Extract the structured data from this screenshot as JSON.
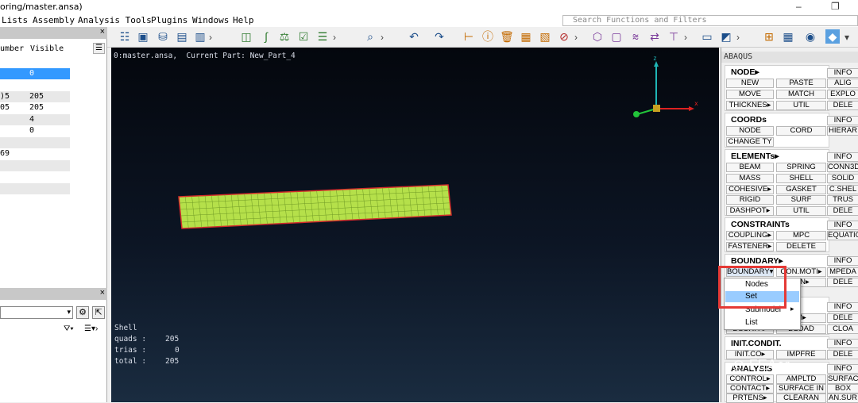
{
  "window": {
    "title": "oring/master.ansa)",
    "controls": [
      "–",
      "❐"
    ]
  },
  "menubar": {
    "items": [
      "Lists",
      "Assembly",
      "Analysis Tools",
      "Plugins",
      "Windows",
      "Help"
    ]
  },
  "search": {
    "placeholder": "Search Functions and Filters"
  },
  "left_panel": {
    "close": "×",
    "col_number": "umber",
    "col_visible": "Visible",
    "rows": [
      {
        "number": "",
        "visible": "0"
      },
      {
        "number": "",
        "visible": ""
      },
      {
        "number": ")5",
        "visible": "205"
      },
      {
        "number": "05",
        "visible": "205"
      },
      {
        "number": "",
        "visible": "4"
      },
      {
        "number": "",
        "visible": "0"
      },
      {
        "number": "",
        "visible": ""
      },
      {
        "number": "69",
        "visible": ""
      },
      {
        "number": "",
        "visible": ""
      },
      {
        "number": "",
        "visible": ""
      },
      {
        "number": "",
        "visible": ""
      }
    ],
    "close2": "×"
  },
  "viewport": {
    "header": "0:master.ansa,  Current Part: New_Part_4",
    "axis_z": "z",
    "axis_x": "x",
    "stats_title": "Shell",
    "stats": [
      {
        "label": "quads :",
        "value": "205"
      },
      {
        "label": "trias :",
        "value": "0"
      },
      {
        "label": "total :",
        "value": "205"
      }
    ],
    "mesh_color": "#b5e04a"
  },
  "right_panel": {
    "title": "ABAQUS",
    "node_head": "NODE▸",
    "node_info": "INFO",
    "node_btns": [
      "NEW",
      "PASTE",
      "ALIG",
      "MOVE",
      "MATCH",
      "EXPLO",
      "THICKNES▸",
      "UTIL",
      "DELE"
    ],
    "coords_head": "COORDs",
    "coords_info": "INFO",
    "coords_btns": [
      "NODE",
      "CORD",
      "HIERAR",
      "CHANGE TY"
    ],
    "elements_head": "ELEMENTs▸",
    "elements_info": "INFO",
    "elements_btns": [
      "BEAM",
      "SPRING",
      "CONN3D",
      "MASS",
      "SHELL",
      "SOLID",
      "COHESIVE▸",
      "GASKET",
      "C.SHEL",
      "RIGID",
      "SURF",
      "TRUS",
      "DASHPOT▸",
      "UTIL",
      "DELE"
    ],
    "constraints_head": "CONSTRAINTs",
    "constraints_info": "INFO",
    "constraints_btns": [
      "COUPLING▸",
      "MPC",
      "EQUATIO",
      "FASTENER▸",
      "DELETE"
    ],
    "boundary_head": "BOUNDARY▸",
    "boundary_info": "INFO",
    "boundary_btns": [
      "BOUNDARY▾",
      "CON.MOTI▸",
      "MPEDA",
      "IAN▸",
      "DELE"
    ],
    "loads_info": "INFO",
    "loads_btns": [
      "M▸",
      "DELE",
      "DSURFA▸",
      "DLOAD",
      "CLOA"
    ],
    "init_head": "INIT.CONDIT.",
    "init_info": "INFO",
    "init_btns": [
      "INIT.CO▸",
      "IMPFRE",
      "DELE"
    ],
    "analysis_head": "ANALYSIS",
    "analysis_info": "INFO",
    "analysis_btns": [
      "CONTROL▸",
      "AMPLTD",
      "SURFAC",
      "CONTACT▸",
      "SURFACE IN",
      "BOX",
      "PRTENS▸",
      "CLEARAN",
      "AN.SUR"
    ]
  },
  "context_menu": {
    "items": [
      "Nodes",
      "Set",
      "Submodel",
      "List"
    ],
    "submenu_arrow": "▸"
  },
  "watermark": "◎ FEAer"
}
